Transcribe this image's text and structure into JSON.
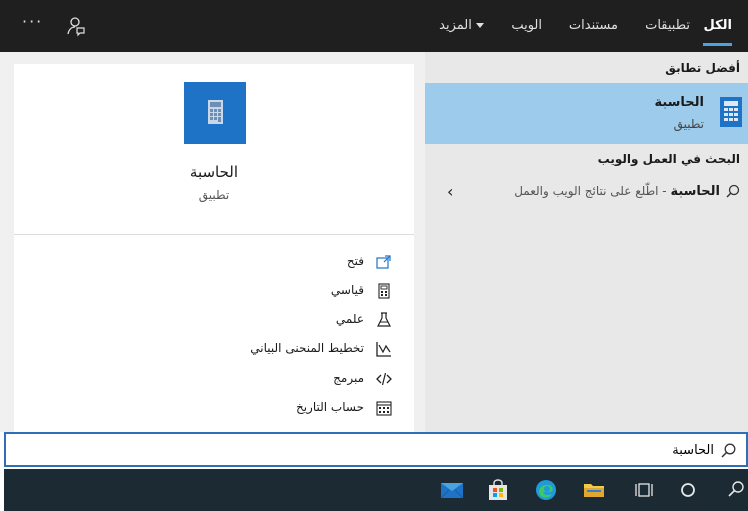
{
  "tabs": [
    {
      "label": "الكل",
      "active": true
    },
    {
      "label": "تطبيقات",
      "active": false
    },
    {
      "label": "مستندات",
      "active": false
    },
    {
      "label": "الويب",
      "active": false
    },
    {
      "label": "المزيد",
      "active": false
    }
  ],
  "topbar": {
    "more_options": "···"
  },
  "best_match": {
    "header": "أفضل تطابق",
    "title": "الحاسبة",
    "subtitle": "تطبيق"
  },
  "web": {
    "header": "البحث في العمل والويب",
    "query": "الحاسبة",
    "separator": " - ",
    "description": "اطّلع على نتائج الويب والعمل"
  },
  "preview": {
    "title": "الحاسبة",
    "subtitle": "تطبيق"
  },
  "actions": [
    {
      "label": "فتح",
      "icon": "open-icon"
    },
    {
      "label": "قياسي",
      "icon": "calculator-icon"
    },
    {
      "label": "علمي",
      "icon": "flask-icon"
    },
    {
      "label": "تخطيط المنحنى البياني",
      "icon": "graph-icon"
    },
    {
      "label": "مبرمج",
      "icon": "code-icon"
    },
    {
      "label": "حساب التاريخ",
      "icon": "calendar-icon"
    }
  ],
  "search": {
    "value": "الحاسبة"
  },
  "taskbar": {
    "apps": [
      "search-icon",
      "cortana-icon",
      "task-view-icon",
      "file-explorer-icon",
      "edge-icon",
      "store-icon",
      "mail-icon"
    ]
  },
  "colors": {
    "accent": "#4aa3df",
    "selected": "#9ccbeb",
    "app_tile": "#1e73c6",
    "topbar": "#1f1f1f",
    "taskbar": "#1c2a33"
  }
}
